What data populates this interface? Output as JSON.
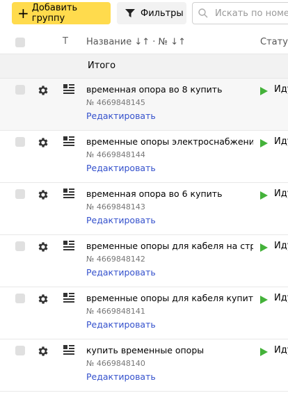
{
  "toolbar": {
    "add_group_label": "Добавить группу",
    "filters_label": "Фильтры",
    "search_placeholder": "Искать по номеру"
  },
  "table": {
    "header": {
      "col_t": "T",
      "name_label": "Название ↓↑ · № ↓↑",
      "status_label": "Статус"
    },
    "total_label": "Итого",
    "rows": [
      {
        "name": "временная опора во 8 купить",
        "number": "№ 4669848145",
        "edit": "Редактировать",
        "status": "Иду"
      },
      {
        "name": "временные опоры электроснабжения",
        "number": "№ 4669848144",
        "edit": "Редактировать",
        "status": "Иду"
      },
      {
        "name": "временная опора во 6 купить",
        "number": "№ 4669848143",
        "edit": "Редактировать",
        "status": "Иду"
      },
      {
        "name": "временные опоры для кабеля на строй",
        "number": "№ 4669848142",
        "edit": "Редактировать",
        "status": "Иду"
      },
      {
        "name": "временные опоры для кабеля купить",
        "number": "№ 4669848141",
        "edit": "Редактировать",
        "status": "Иду"
      },
      {
        "name": "купить временные опоры",
        "number": "№ 4669848140",
        "edit": "Редактировать",
        "status": "Иду"
      }
    ]
  },
  "colors": {
    "accent_yellow": "#ffdb4d",
    "link_blue": "#3350cc",
    "status_green": "#44b23a"
  },
  "icons": [
    "plus-icon",
    "filter-icon",
    "search-icon",
    "gear-icon",
    "list-icon",
    "play-status-icon"
  ]
}
